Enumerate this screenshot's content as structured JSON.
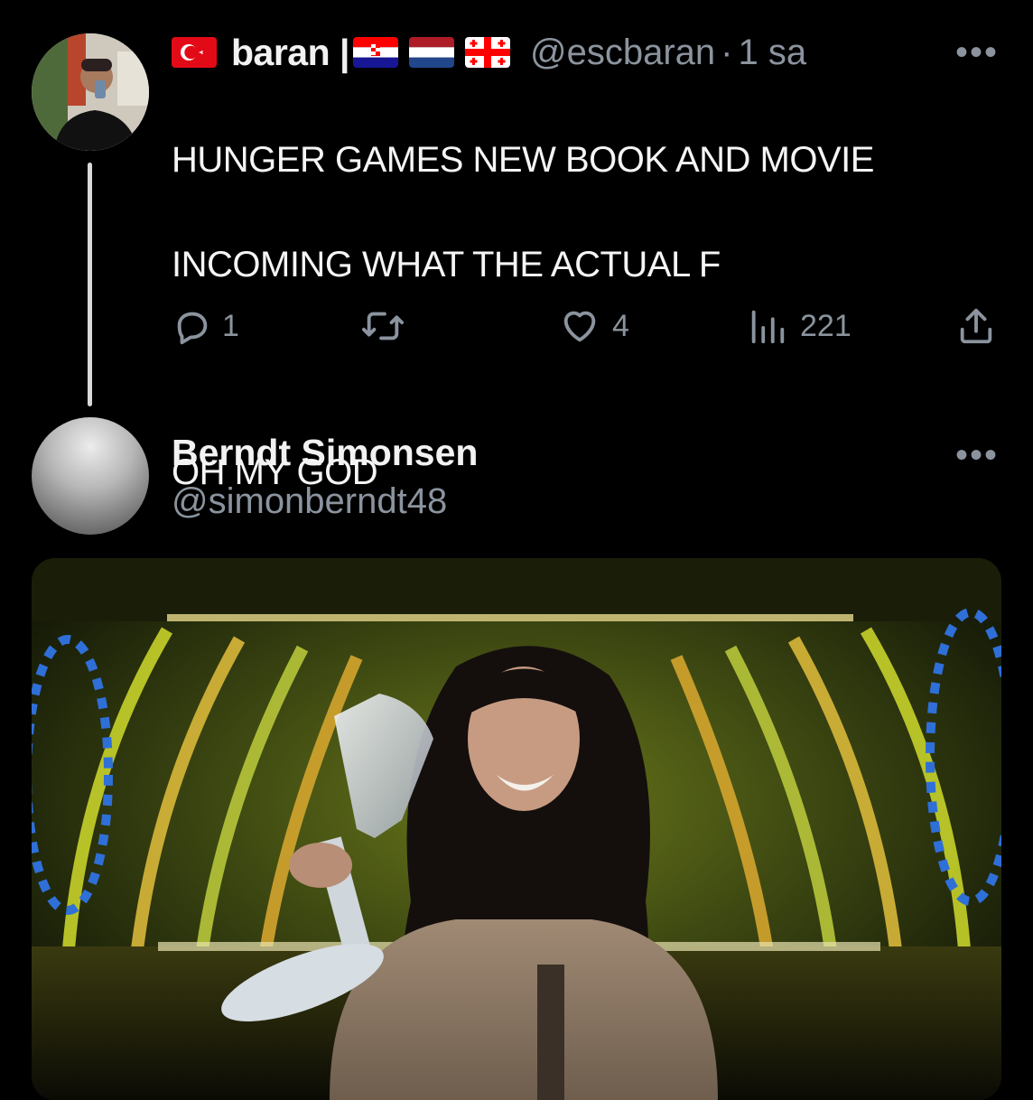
{
  "tweet1": {
    "display_name": "baran |",
    "handle": "@escbaran",
    "separator": "·",
    "time": "1 sa",
    "more": "•••",
    "text_line1": "HUNGER GAMES NEW BOOK AND MOVIE",
    "text_line2": "INCOMING WHAT THE ACTUAL F",
    "text_line3": "OH MY GOD",
    "flags": [
      "turkey-flag",
      "croatia-flag",
      "netherlands-flag",
      "georgia-flag"
    ],
    "actions": {
      "replies": "1",
      "retweets": "",
      "likes": "4",
      "views": "221"
    }
  },
  "tweet2": {
    "display_name": "Berndt Simonsen",
    "handle": "@simonberndt48",
    "more": "•••"
  },
  "colors": {
    "background": "#000000",
    "text": "#e7e9ea",
    "secondary": "#8b949e",
    "thread_line": "#d9d9d9"
  }
}
